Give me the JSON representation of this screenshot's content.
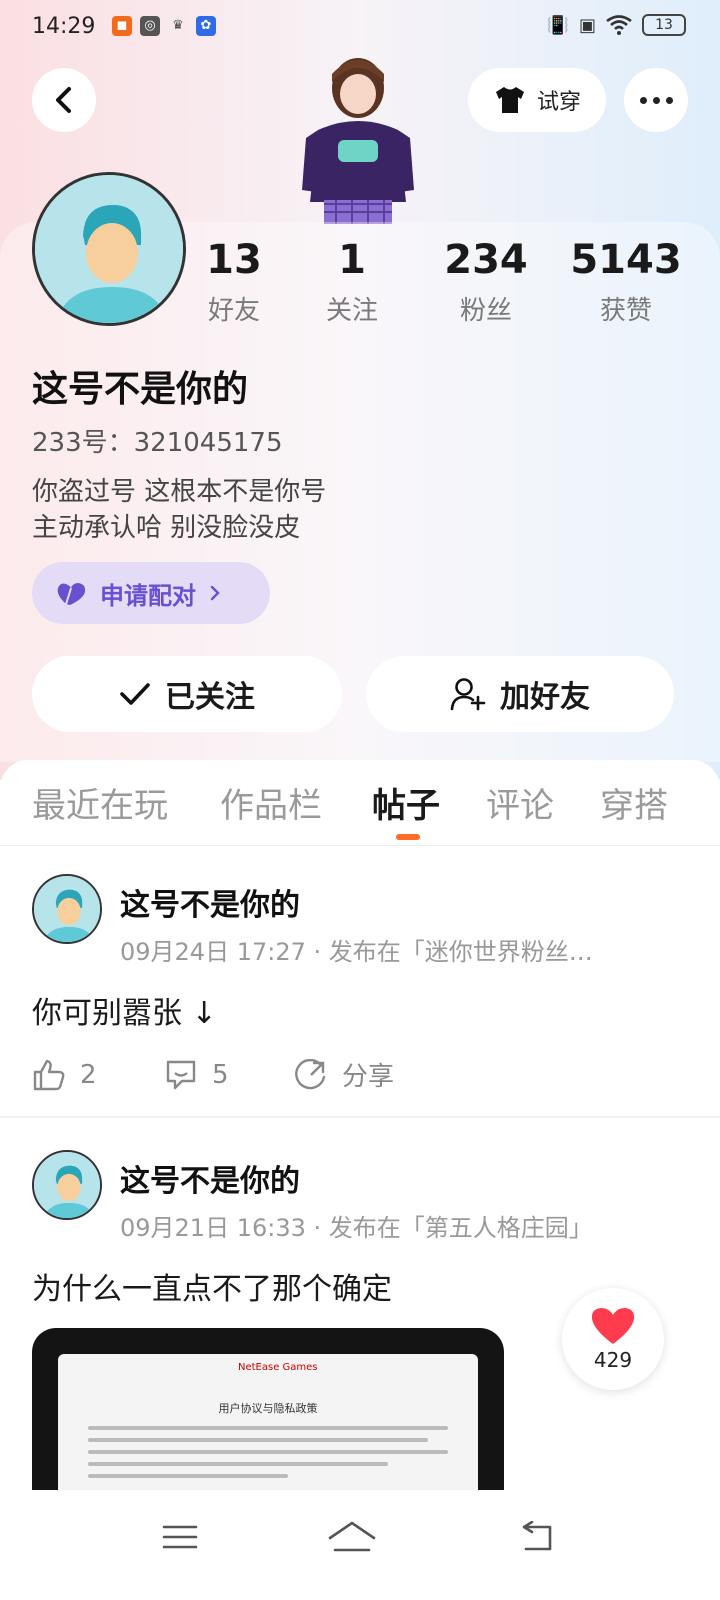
{
  "status_bar": {
    "time": "14:29",
    "battery": "13"
  },
  "header": {
    "try_on_label": "试穿"
  },
  "profile": {
    "stats": [
      {
        "value": "13",
        "label": "好友"
      },
      {
        "value": "1",
        "label": "关注"
      },
      {
        "value": "234",
        "label": "粉丝"
      },
      {
        "value": "5143",
        "label": "获赞"
      }
    ],
    "name": "这号不是你的",
    "id_text": "233号：321045175",
    "bio_line1": "你盗过号 这根本不是你号",
    "bio_line2": "主动承认哈 别没脸没皮",
    "pair_label": "申请配对",
    "follow_label": "已关注",
    "add_friend_label": "加好友"
  },
  "tabs": [
    {
      "label": "最近在玩"
    },
    {
      "label": "作品栏"
    },
    {
      "label": "帖子",
      "active": true
    },
    {
      "label": "评论"
    },
    {
      "label": "穿搭"
    }
  ],
  "posts": [
    {
      "author": "这号不是你的",
      "meta": "09月24日 17:27 · 发布在「迷你世界粉丝…",
      "text": "你可别嚣张 ↓",
      "likes": "2",
      "comments": "5",
      "share_label": "分享"
    },
    {
      "author": "这号不是你的",
      "meta": "09月21日 16:33 · 发布在「第五人格庄园」",
      "text": "为什么一直点不了那个确定",
      "image_doc_title": "用户协议与隐私政策",
      "image_logo": "NetEase Games"
    }
  ],
  "floating_like": {
    "count": "429"
  },
  "colors": {
    "accent": "#ff6b2b",
    "pair_text": "#6a4fcf",
    "pair_bg": "#e4dcf6",
    "heart": "#ff3b4e"
  }
}
